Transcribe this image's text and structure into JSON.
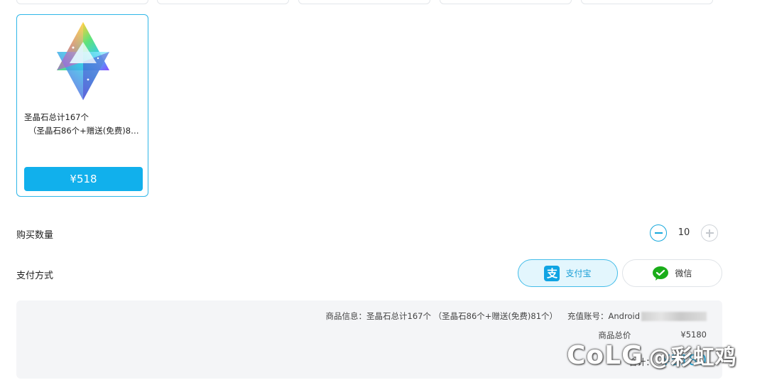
{
  "product": {
    "name_line1": "圣晶石总计167个",
    "name_line2": "（圣晶石86个+赠送(免费)81...",
    "price": "¥518"
  },
  "quantity": {
    "label": "购买数量",
    "value": "10"
  },
  "payment": {
    "label": "支付方式",
    "alipay_icon_char": "支",
    "alipay_label": "支付宝",
    "wechat_label": "微信",
    "selected": "alipay",
    "accent_color": "#11b0ec"
  },
  "summary": {
    "product_info_label": "商品信息：",
    "product_info_value": "圣晶石总计167个 （圣晶石86个+赠送(免费)81个）",
    "account_label": "充值账号：",
    "account_value": "Android",
    "total_label": "商品总价",
    "total_value": "¥5180",
    "grand_label": "合计：",
    "grand_value": "¥5180"
  },
  "watermark": {
    "logo": "CoLG",
    "text": "@彩虹鸡"
  }
}
